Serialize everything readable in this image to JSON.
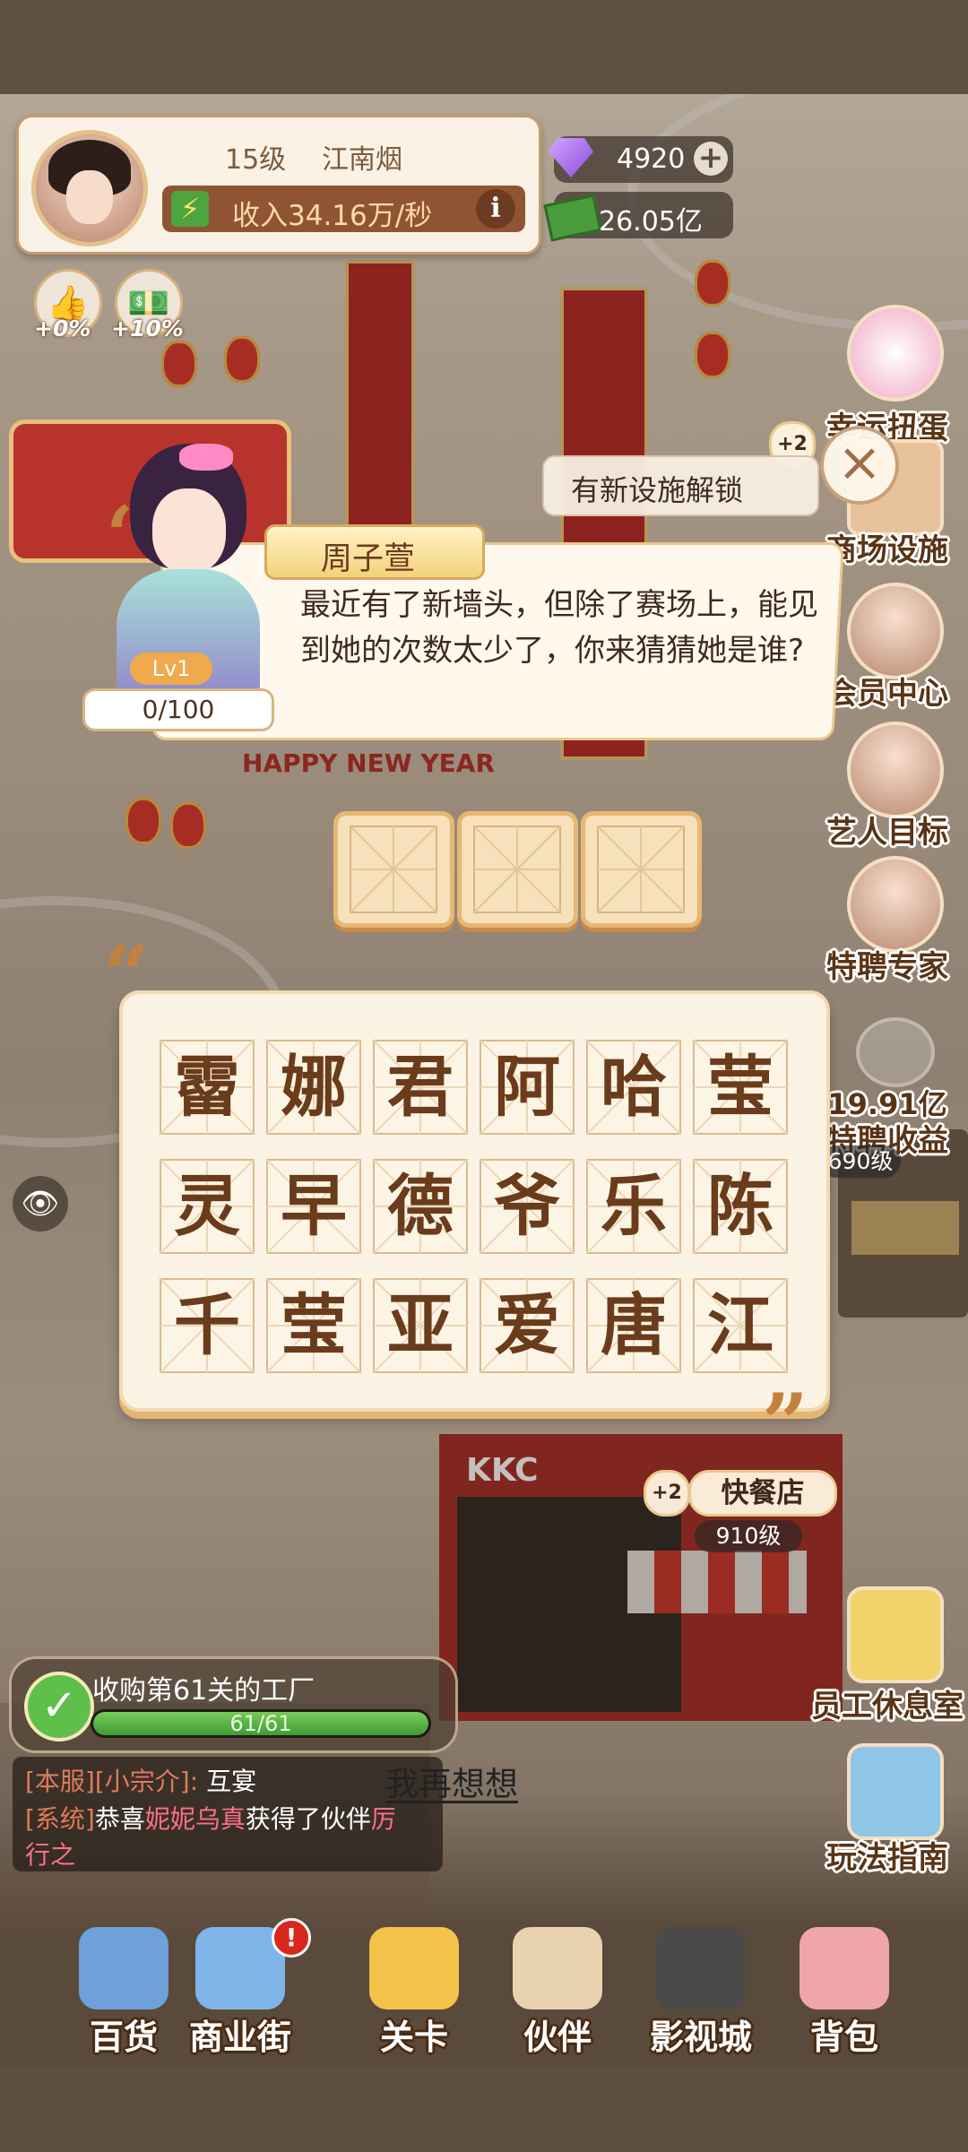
{
  "player": {
    "level": "15级",
    "name": "江南烟",
    "income": "收入34.16万/秒",
    "info_icon": "i"
  },
  "resources": {
    "gems": "4920",
    "cash": "26.05亿"
  },
  "buffs": [
    {
      "icon": "thumbs-up-icon",
      "value": "+0%"
    },
    {
      "icon": "cash-lightning-icon",
      "value": "+10%"
    }
  ],
  "unlock_tip": "有新设施解锁",
  "dialog": {
    "speaker": "周子萱",
    "text": "最近有了新墙头，但除了赛场上，能见到她的次数太少了，你来猜猜她是谁?",
    "level_badge": "Lv1",
    "progress": "0/100"
  },
  "answer_slots": 3,
  "letters": [
    [
      "霤",
      "娜",
      "君",
      "阿",
      "哈",
      "莹"
    ],
    [
      "灵",
      "早",
      "德",
      "爷",
      "乐",
      "陈"
    ],
    [
      "千",
      "莹",
      "亚",
      "爱",
      "唐",
      "江"
    ]
  ],
  "side_menu": [
    {
      "label": "幸运扭蛋"
    },
    {
      "label": "商场设施"
    },
    {
      "label": "会员中心"
    },
    {
      "label": "艺人目标"
    },
    {
      "label": "特聘专家"
    },
    {
      "label": "特聘收益",
      "value": "19.91亿"
    },
    {
      "label": "员工休息室"
    },
    {
      "label": "玩法指南"
    }
  ],
  "scene": {
    "fast_food_label": "快餐店",
    "fast_food_level": "910级",
    "badge_plus": "+2",
    "store_sign": "KKC",
    "expert_level": "690级",
    "banner_text": "HAPPY NEW YEAR"
  },
  "mission": {
    "title": "收购第61关的工厂",
    "count": "61/61",
    "progress": 1.0
  },
  "chat": {
    "line1_tag": "[本服]",
    "line1_user": "[小宗介]:",
    "line1_msg": "互宴",
    "line2_tag": "[系统]",
    "line2_pre": "恭喜",
    "line2_user": "妮妮乌真",
    "line2_msg": "获得了伙伴",
    "line2_partner": "厉",
    "line3": "行之"
  },
  "think_again": "我再想想",
  "bottom_nav": [
    {
      "label": "百货",
      "color": "#6fa0d8"
    },
    {
      "label": "商业街",
      "color": "#7fb5e8",
      "alert": "!"
    },
    {
      "label": "关卡",
      "color": "#f2c24a"
    },
    {
      "label": "伙伴",
      "color": "#e8d2b0"
    },
    {
      "label": "影视城",
      "color": "#4a4a4a"
    },
    {
      "label": "背包",
      "color": "#f0a6a8"
    }
  ]
}
